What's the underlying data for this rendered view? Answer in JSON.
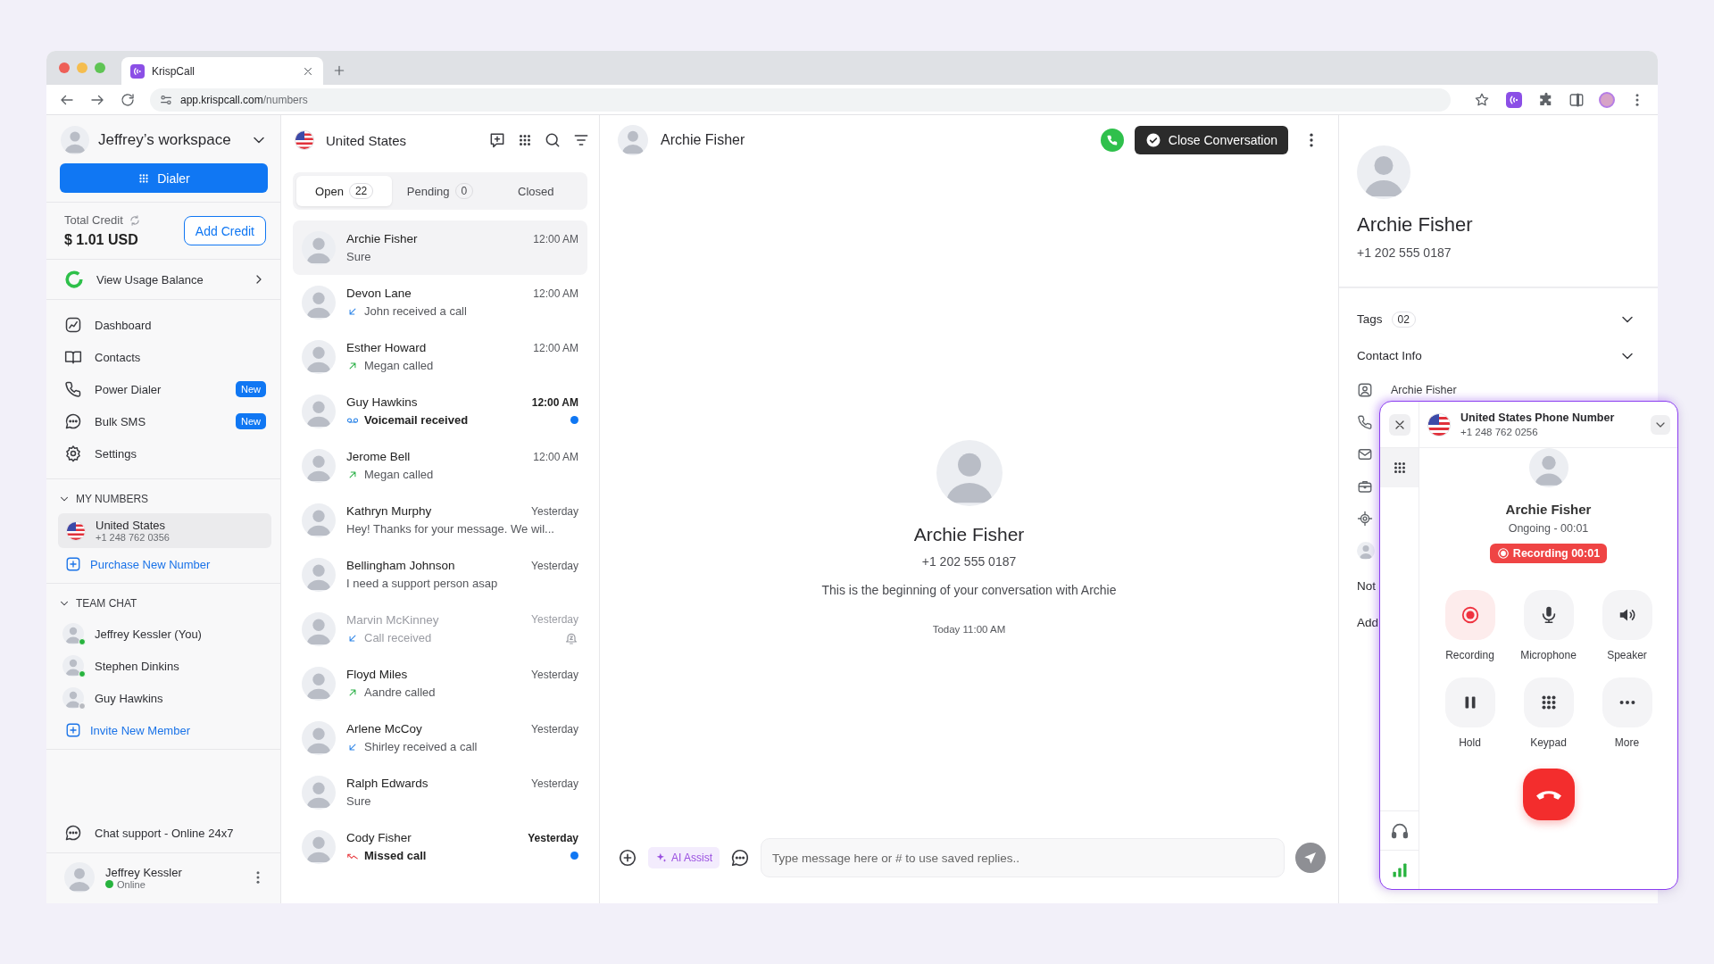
{
  "browser": {
    "tab_title": "KrispCall",
    "url_host": "app.krispcall.com",
    "url_path": "/numbers"
  },
  "sidebar": {
    "workspace": "Jeffrey’s workspace",
    "dialer": "Dialer",
    "credit_label": "Total Credit",
    "credit_amount": "$ 1.01 USD",
    "add_credit": "Add Credit",
    "usage": "View Usage Balance",
    "nav": [
      {
        "kind": "dashboard",
        "label": "Dashboard"
      },
      {
        "kind": "contacts",
        "label": "Contacts"
      },
      {
        "kind": "power-dialer",
        "label": "Power Dialer",
        "badge": "New"
      },
      {
        "kind": "bulk-sms",
        "label": "Bulk SMS",
        "badge": "New"
      },
      {
        "kind": "settings",
        "label": "Settings"
      }
    ],
    "my_numbers": {
      "heading": "MY NUMBERS",
      "expanded": true,
      "numbers": [
        {
          "name": "United States",
          "phone": "+1 248 762 0356",
          "selected": true
        }
      ],
      "purchase": "Purchase New Number"
    },
    "team_chat": {
      "heading": "TEAM CHAT",
      "expanded": true,
      "members": [
        {
          "name": "Jeffrey Kessler (You)",
          "online": true
        },
        {
          "name": "Stephen Dinkins",
          "online": true
        },
        {
          "name": "Guy Hawkins",
          "online": false
        }
      ],
      "invite": "Invite New Member"
    },
    "support": "Chat support - Online 24x7",
    "user": {
      "name": "Jeffrey Kessler",
      "status": "Online",
      "online": true
    }
  },
  "conversations": {
    "number": "United States",
    "tabs": [
      {
        "label": "Open",
        "count": "22",
        "selected": true
      },
      {
        "label": "Pending",
        "count": "0",
        "selected": false
      },
      {
        "label": "Closed",
        "selected": false
      }
    ],
    "items": [
      {
        "name": "Archie Fisher",
        "kind": "message",
        "preview": "Sure",
        "time": "12:00 AM",
        "unread": false,
        "muted": false,
        "selected": true
      },
      {
        "name": "Devon Lane",
        "kind": "incoming",
        "preview": "John received a call",
        "time": "12:00 AM",
        "unread": false,
        "muted": false,
        "selected": false
      },
      {
        "name": "Esther Howard",
        "kind": "outgoing",
        "preview": "Megan called",
        "time": "12:00 AM",
        "unread": false,
        "muted": false,
        "selected": false
      },
      {
        "name": "Guy Hawkins",
        "kind": "voicemail",
        "preview": "Voicemail received",
        "time": "12:00 AM",
        "unread": true,
        "muted": false,
        "selected": false
      },
      {
        "name": "Jerome Bell",
        "kind": "outgoing",
        "preview": "Megan called",
        "time": "12:00 AM",
        "unread": false,
        "muted": false,
        "selected": false
      },
      {
        "name": "Kathryn Murphy",
        "kind": "message",
        "preview": "Hey! Thanks for your message. We wil...",
        "time": "Yesterday",
        "unread": false,
        "muted": false,
        "selected": false
      },
      {
        "name": "Bellingham Johnson",
        "kind": "message",
        "preview": "I need a support person asap",
        "time": "Yesterday",
        "unread": false,
        "muted": false,
        "selected": false
      },
      {
        "name": "Marvin McKinney",
        "kind": "incoming",
        "preview": "Call received",
        "time": "Yesterday",
        "unread": false,
        "muted": true,
        "selected": false
      },
      {
        "name": "Floyd Miles",
        "kind": "outgoing",
        "preview": "Aandre called",
        "time": "Yesterday",
        "unread": false,
        "muted": false,
        "selected": false
      },
      {
        "name": "Arlene McCoy",
        "kind": "incoming",
        "preview": "Shirley received a call",
        "time": "Yesterday",
        "unread": false,
        "muted": false,
        "selected": false
      },
      {
        "name": "Ralph Edwards",
        "kind": "message",
        "preview": "Sure",
        "time": "Yesterday",
        "unread": false,
        "muted": false,
        "selected": false
      },
      {
        "name": "Cody Fisher",
        "kind": "missed",
        "preview": "Missed call",
        "time": "Yesterday",
        "unread": true,
        "muted": false,
        "selected": false
      }
    ]
  },
  "chat": {
    "name": "Archie Fisher",
    "close_button": "Close Conversation",
    "intro": {
      "name": "Archie Fisher",
      "phone": "+1 202 555 0187",
      "text": "This is the beginning of your conversation with Archie",
      "date": "Today 11:00 AM"
    },
    "ai_assist": "AI Assist",
    "placeholder": "Type message here or # to use saved replies.."
  },
  "contact": {
    "name": "Archie Fisher",
    "phone": "+1 202 555 0187",
    "tags_label": "Tags",
    "tags_count": "02",
    "info_label": "Contact Info",
    "info_name": "Archie Fisher",
    "notes_label": "Not",
    "add_label": "Add"
  },
  "call": {
    "line": "United States Phone Number",
    "line_number": "+1 248 762 0256",
    "name": "Archie Fisher",
    "status": "Ongoing - 00:01",
    "recording": "Recording 00:01",
    "controls": [
      {
        "kind": "record",
        "label": "Recording",
        "active": true
      },
      {
        "kind": "mic",
        "label": "Microphone",
        "active": false
      },
      {
        "kind": "speaker",
        "label": "Speaker",
        "active": false
      },
      {
        "kind": "hold",
        "label": "Hold",
        "active": false
      },
      {
        "kind": "keypad",
        "label": "Keypad",
        "active": false
      },
      {
        "kind": "more",
        "label": "More",
        "active": false
      }
    ]
  }
}
